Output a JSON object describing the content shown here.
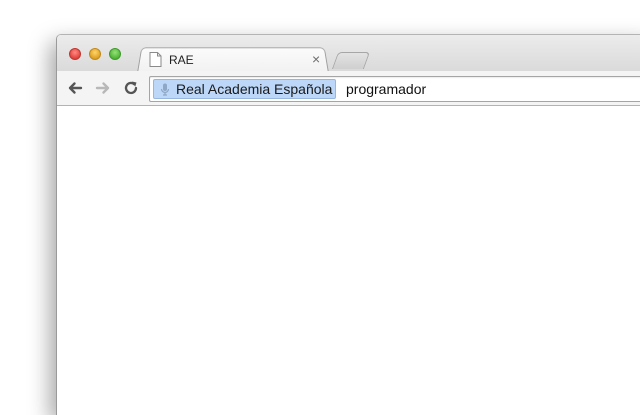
{
  "tab": {
    "title": "RAE",
    "close_glyph": "×",
    "icon": "page-icon"
  },
  "toolbar": {
    "back_icon": "back-arrow-icon",
    "forward_icon": "forward-arrow-icon",
    "reload_icon": "reload-icon"
  },
  "omnibox": {
    "search_engine_chip": "Real Academia Española",
    "query": "programador",
    "chip_icon": "microphone-icon"
  },
  "colors": {
    "chip_background": "#bcd7f8",
    "close_button": "#e0443e",
    "minimize_button": "#dea123",
    "zoom_button": "#4fb636"
  }
}
